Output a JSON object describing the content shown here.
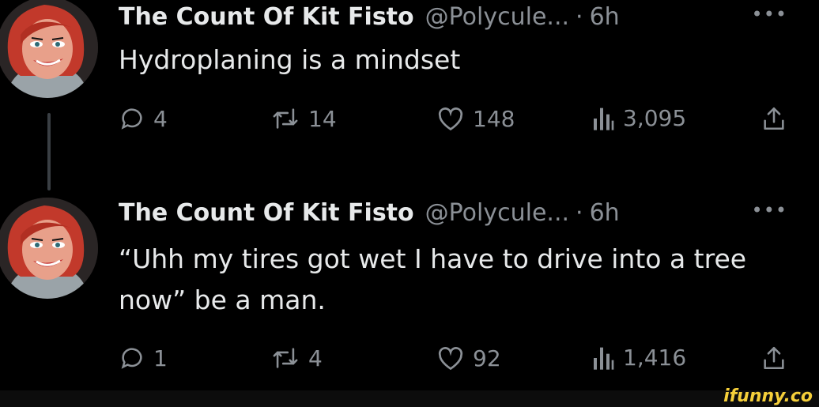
{
  "tweets": [
    {
      "author": "The Count Of Kit Fisto",
      "handle": "@Polycule...",
      "separator": "·",
      "time": "6h",
      "more": "•••",
      "text": "Hydroplaning is a mindset",
      "replies": "4",
      "retweets": "14",
      "likes": "148",
      "views": "3,095"
    },
    {
      "author": "The Count Of Kit Fisto",
      "handle": "@Polycule...",
      "separator": "·",
      "time": "6h",
      "more": "•••",
      "text": "“Uhh my tires got wet I have to drive into a tree now” be a man.",
      "replies": "1",
      "retweets": "4",
      "likes": "92",
      "views": "1,416"
    }
  ],
  "icons": {
    "reply": "reply-icon",
    "retweet": "retweet-icon",
    "like": "heart-icon",
    "views": "views-icon",
    "share": "share-icon"
  },
  "colors": {
    "background": "#000000",
    "text": "#e7e9ea",
    "muted": "#8b9096",
    "watermark": "#f5cf3a"
  },
  "watermark": "ifunny.co"
}
